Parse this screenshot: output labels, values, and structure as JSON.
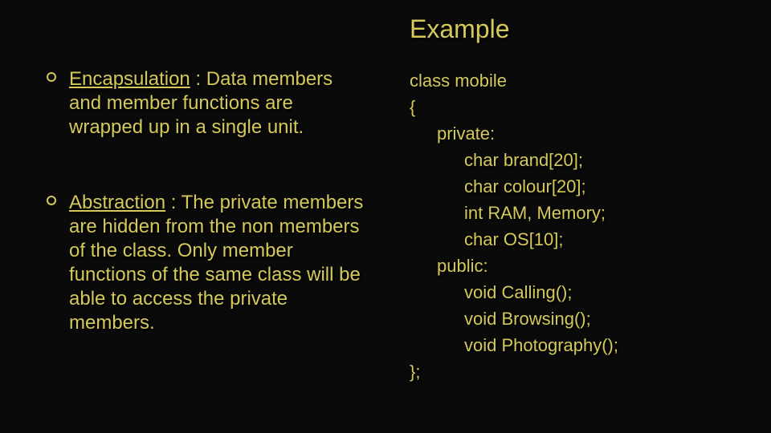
{
  "title": "Example",
  "left": {
    "b1_term": "Encapsulation",
    "b1_rest": " : Data members and member functions are wrapped up in a single unit.",
    "b2_term": "Abstraction",
    "b2_rest": " : The private members are hidden from the non members of the class. Only member functions of the same class will be able to access the private members."
  },
  "code": {
    "l0": "class mobile",
    "l1": "{",
    "l2": "private:",
    "l3": "char brand[20];",
    "l4": "char colour[20];",
    "l5": "int RAM, Memory;",
    "l6": "char OS[10];",
    "l7": "public:",
    "l8": "void Calling();",
    "l9": "void Browsing();",
    "l10": "void Photography();",
    "l11": "};"
  }
}
